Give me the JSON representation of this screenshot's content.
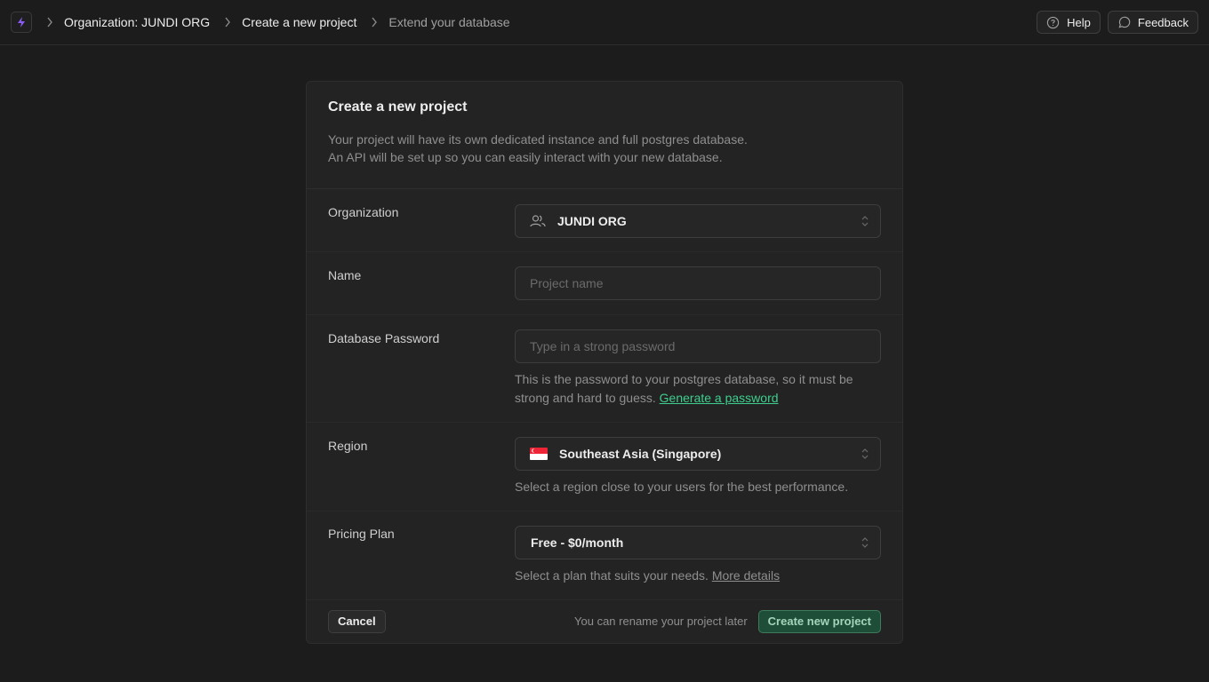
{
  "breadcrumb": {
    "items": [
      "Organization: JUNDI ORG",
      "Create a new project",
      "Extend your database"
    ]
  },
  "header_actions": {
    "help_label": "Help",
    "feedback_label": "Feedback"
  },
  "panel": {
    "title": "Create a new project",
    "description_line1": "Your project will have its own dedicated instance and full postgres database.",
    "description_line2": "An API will be set up so you can easily interact with your new database."
  },
  "form": {
    "organization": {
      "label": "Organization",
      "value": "JUNDI ORG"
    },
    "name": {
      "label": "Name",
      "placeholder": "Project name",
      "value": ""
    },
    "password": {
      "label": "Database Password",
      "placeholder": "Type in a strong password",
      "help_line1": "This is the password to your postgres database, so it must be",
      "help_line2": "strong and hard to guess.",
      "generate_link": "Generate a password"
    },
    "region": {
      "label": "Region",
      "value": "Southeast Asia (Singapore)",
      "help": "Select a region close to your users for the best performance."
    },
    "plan": {
      "label": "Pricing Plan",
      "value": "Free - $0/month",
      "help": "Select a plan that suits your needs.",
      "more_link": "More details"
    }
  },
  "footer": {
    "cancel_label": "Cancel",
    "note": "You can rename your project later",
    "create_label": "Create new project"
  },
  "colors": {
    "background": "#1c1c1c",
    "panel": "#232323",
    "accent_green": "#3ecf8e",
    "logo_purple": "#8b5cf6"
  }
}
